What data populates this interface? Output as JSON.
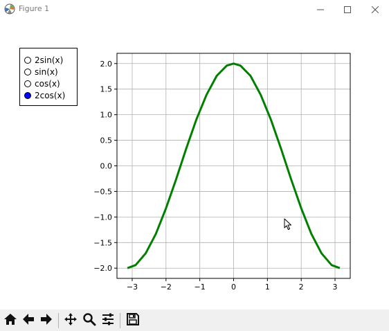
{
  "window": {
    "title": "Figure 1",
    "controls": [
      "minimize-icon",
      "maximize-icon",
      "close-icon"
    ]
  },
  "radio": {
    "options": [
      {
        "label": "2sin(x)",
        "selected": false
      },
      {
        "label": "sin(x)",
        "selected": false
      },
      {
        "label": "cos(x)",
        "selected": false
      },
      {
        "label": "2cos(x)",
        "selected": true
      }
    ],
    "selected_color": "#0000ff"
  },
  "toolbar": {
    "buttons": [
      "home-icon",
      "back-icon",
      "forward-icon",
      "pan-icon",
      "zoom-icon",
      "configure-subplots-icon",
      "save-icon"
    ]
  },
  "chart_data": {
    "type": "line",
    "title": "",
    "xlabel": "",
    "ylabel": "",
    "xlim": [
      -3.45,
      3.45
    ],
    "ylim": [
      -2.2,
      2.2
    ],
    "xticks": [
      -3,
      -2,
      -1,
      0,
      1,
      2,
      3
    ],
    "xtick_labels": [
      "−3",
      "−2",
      "−1",
      "0",
      "1",
      "2",
      "3"
    ],
    "yticks": [
      -2.0,
      -1.5,
      -1.0,
      -0.5,
      0.0,
      0.5,
      1.0,
      1.5,
      2.0
    ],
    "ytick_labels": [
      "−2.0",
      "−1.5",
      "−1.0",
      "−0.5",
      "0.0",
      "0.5",
      "1.0",
      "1.5",
      "2.0"
    ],
    "grid": true,
    "series": [
      {
        "color": "#007f00",
        "x": [
          -3.14,
          -2.9,
          -2.6,
          -2.3,
          -2.0,
          -1.7,
          -1.4,
          -1.1,
          -0.8,
          -0.5,
          -0.2,
          0.0,
          0.2,
          0.5,
          0.8,
          1.1,
          1.4,
          1.7,
          2.0,
          2.3,
          2.6,
          2.9,
          3.14
        ],
        "y": [
          -2.0,
          -1.94,
          -1.71,
          -1.33,
          -0.83,
          -0.26,
          0.34,
          0.91,
          1.39,
          1.76,
          1.96,
          2.0,
          1.96,
          1.76,
          1.39,
          0.91,
          0.34,
          -0.26,
          -0.83,
          -1.33,
          -1.71,
          -1.94,
          -2.0
        ]
      }
    ]
  }
}
